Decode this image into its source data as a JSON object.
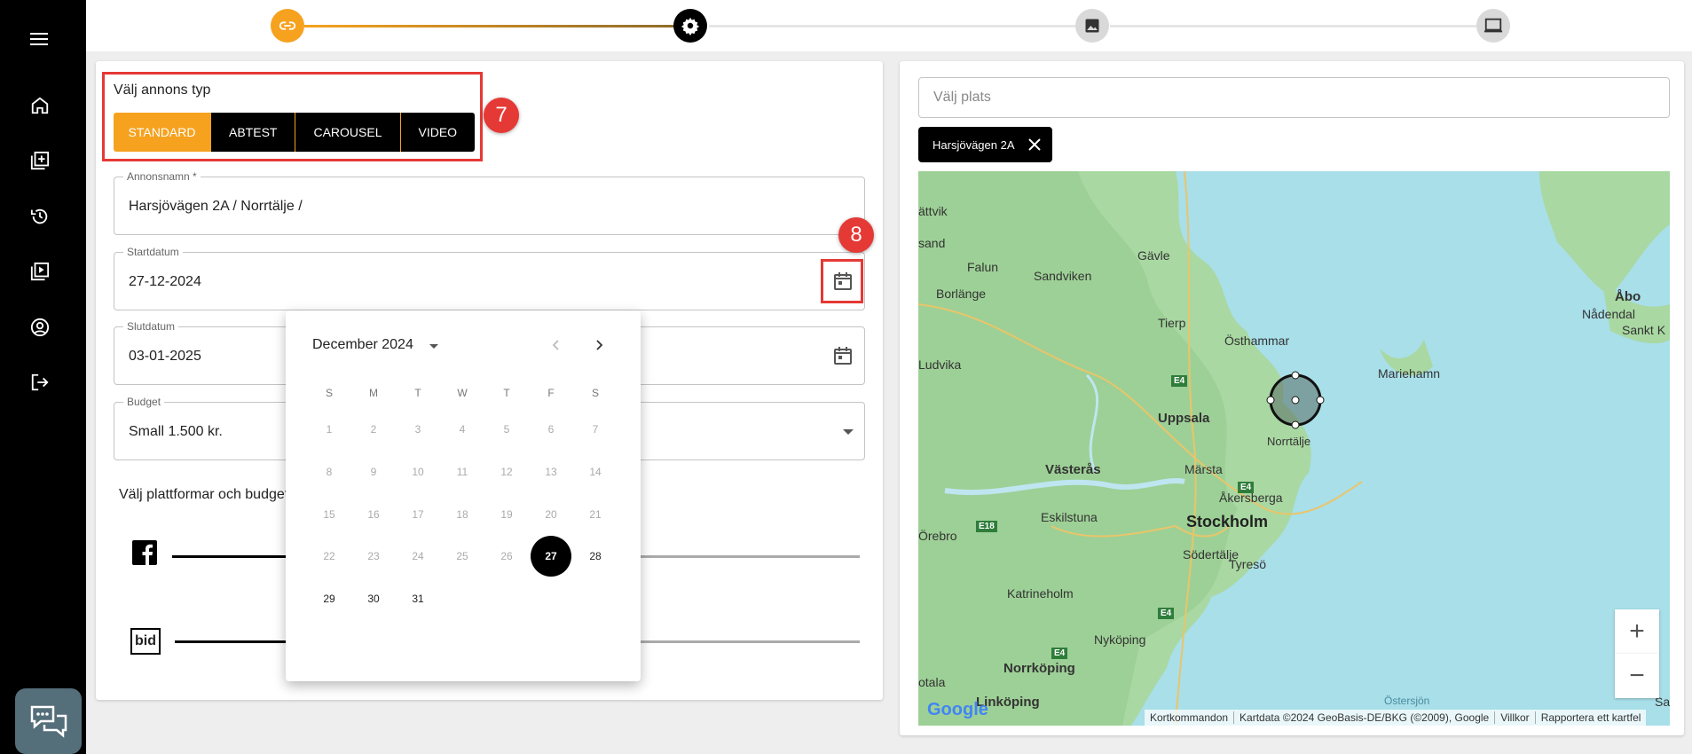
{
  "sidebar": {
    "items": [
      {
        "name": "menu-icon"
      },
      {
        "name": "home-icon"
      },
      {
        "name": "add-ad-icon"
      },
      {
        "name": "history-icon"
      },
      {
        "name": "video-library-icon"
      },
      {
        "name": "account-icon"
      },
      {
        "name": "logout-icon"
      }
    ],
    "chat_icon": "chat-bubbles-icon"
  },
  "stepper": {
    "steps": [
      {
        "name": "link-icon",
        "state": "done",
        "color": "#f6a21f"
      },
      {
        "name": "settings-icon",
        "state": "active",
        "color": "#000000"
      },
      {
        "name": "image-icon",
        "state": "pending",
        "color": "#d9d9d9"
      },
      {
        "name": "monitor-icon",
        "state": "pending",
        "color": "#d9d9d9"
      }
    ]
  },
  "ad_type": {
    "title": "Välj annons typ",
    "options": [
      "STANDARD",
      "ABTEST",
      "CAROUSEL",
      "VIDEO"
    ],
    "selected": "STANDARD"
  },
  "annotations": {
    "badge_7": "7",
    "badge_8": "8",
    "color": "#e53935"
  },
  "form": {
    "name": {
      "label": "Annonsnamn *",
      "value": "Harsjövägen 2A / Norrtälje /"
    },
    "start": {
      "label": "Startdatum",
      "value": "27-12-2024"
    },
    "end": {
      "label": "Slutdatum",
      "value": "03-01-2025"
    },
    "budget": {
      "label": "Budget",
      "value": "Small 1.500 kr."
    },
    "platforms_label": "Välj plattformar och budget",
    "platforms": [
      {
        "name": "facebook-icon"
      },
      {
        "name": "bid-logo",
        "text": "bid"
      }
    ]
  },
  "datepicker": {
    "month_label": "December 2024",
    "weekdays": [
      "S",
      "M",
      "T",
      "W",
      "T",
      "F",
      "S"
    ],
    "weeks": [
      [
        "1",
        "2",
        "3",
        "4",
        "5",
        "6",
        "7"
      ],
      [
        "8",
        "9",
        "10",
        "11",
        "12",
        "13",
        "14"
      ],
      [
        "15",
        "16",
        "17",
        "18",
        "19",
        "20",
        "21"
      ],
      [
        "22",
        "23",
        "24",
        "25",
        "26",
        "27",
        "28"
      ],
      [
        "29",
        "30",
        "31"
      ]
    ],
    "selected": "27",
    "enabled_from": "27"
  },
  "location": {
    "placeholder": "Välj plats",
    "chip": "Harsjövägen 2A"
  },
  "map": {
    "labels": [
      "ättvik",
      "sand",
      "Falun",
      "Gävle",
      "Sandviken",
      "Borlänge",
      "Tierp",
      "Östhammar",
      "Mariehamn",
      "Ludvika",
      "Uppsala",
      "Norrtälje",
      "Västerås",
      "Märsta",
      "Åkersberga",
      "Stockholm",
      "Eskilstuna",
      "Örebro",
      "Södertälje",
      "Tyresö",
      "Katrineholm",
      "Nyköping",
      "Norrköping",
      "otala",
      "Linköping",
      "Östersjön",
      "Åbo",
      "Nådendal",
      "Sankt K",
      "Sa"
    ],
    "roads": [
      "E4",
      "E18",
      "E4",
      "E4",
      "E4"
    ],
    "zoom_in": "+",
    "zoom_out": "−",
    "attribution": [
      "Kortkommandon",
      "Kartdata ©2024 GeoBasis-DE/BKG (©2009), Google",
      "Villkor",
      "Rapportera ett kartfel"
    ],
    "google_logo": "Google"
  }
}
